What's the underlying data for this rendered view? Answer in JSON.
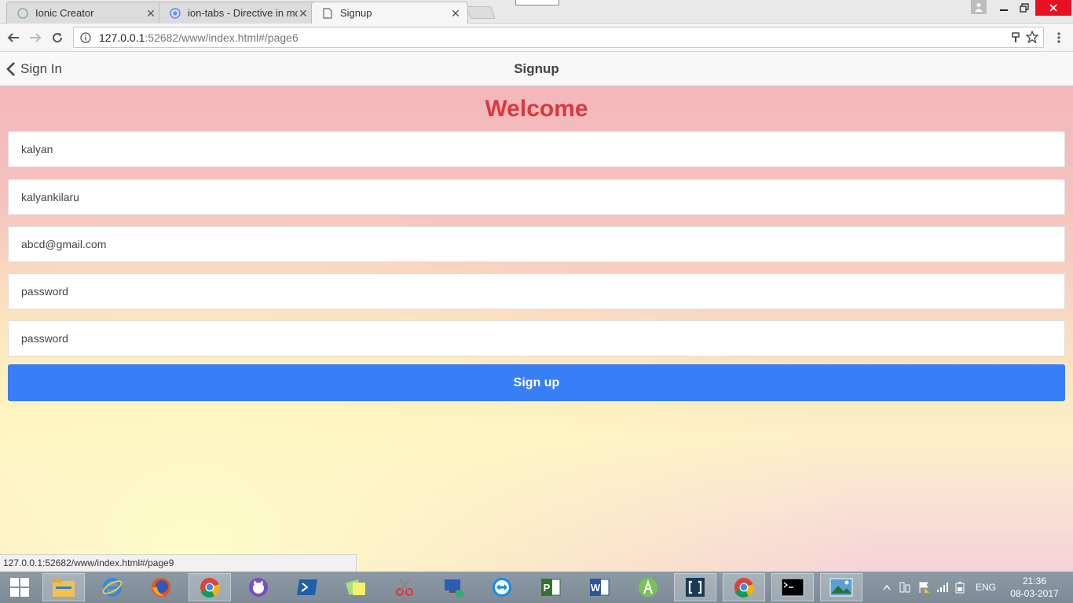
{
  "browser": {
    "tabs": [
      {
        "title": "Ionic Creator",
        "close": "✕"
      },
      {
        "title": "ion-tabs - Directive in mo",
        "close": "✕"
      },
      {
        "title": "Signup",
        "close": "✕"
      }
    ],
    "url_host": "127.0.0.1",
    "url_rest": ":52682/www/index.html#/page6",
    "status_url": "127.0.0.1:52682/www/index.html#/page9"
  },
  "app": {
    "back_label": "Sign In",
    "title": "Signup",
    "welcome": "Welcome",
    "fields": [
      {
        "name": "name-field",
        "value": "kalyan"
      },
      {
        "name": "username-field",
        "value": "kalyankilaru"
      },
      {
        "name": "email-field",
        "value": "abcd@gmail.com"
      },
      {
        "name": "password-field",
        "value": "password"
      },
      {
        "name": "confirm-password-field",
        "value": "password"
      }
    ],
    "signup_label": "Sign up"
  },
  "taskbar": {
    "language": "ENG",
    "time": "21:36",
    "date": "08-03-2017"
  },
  "colors": {
    "accent": "#387ef5",
    "welcome": "#d9393f"
  }
}
